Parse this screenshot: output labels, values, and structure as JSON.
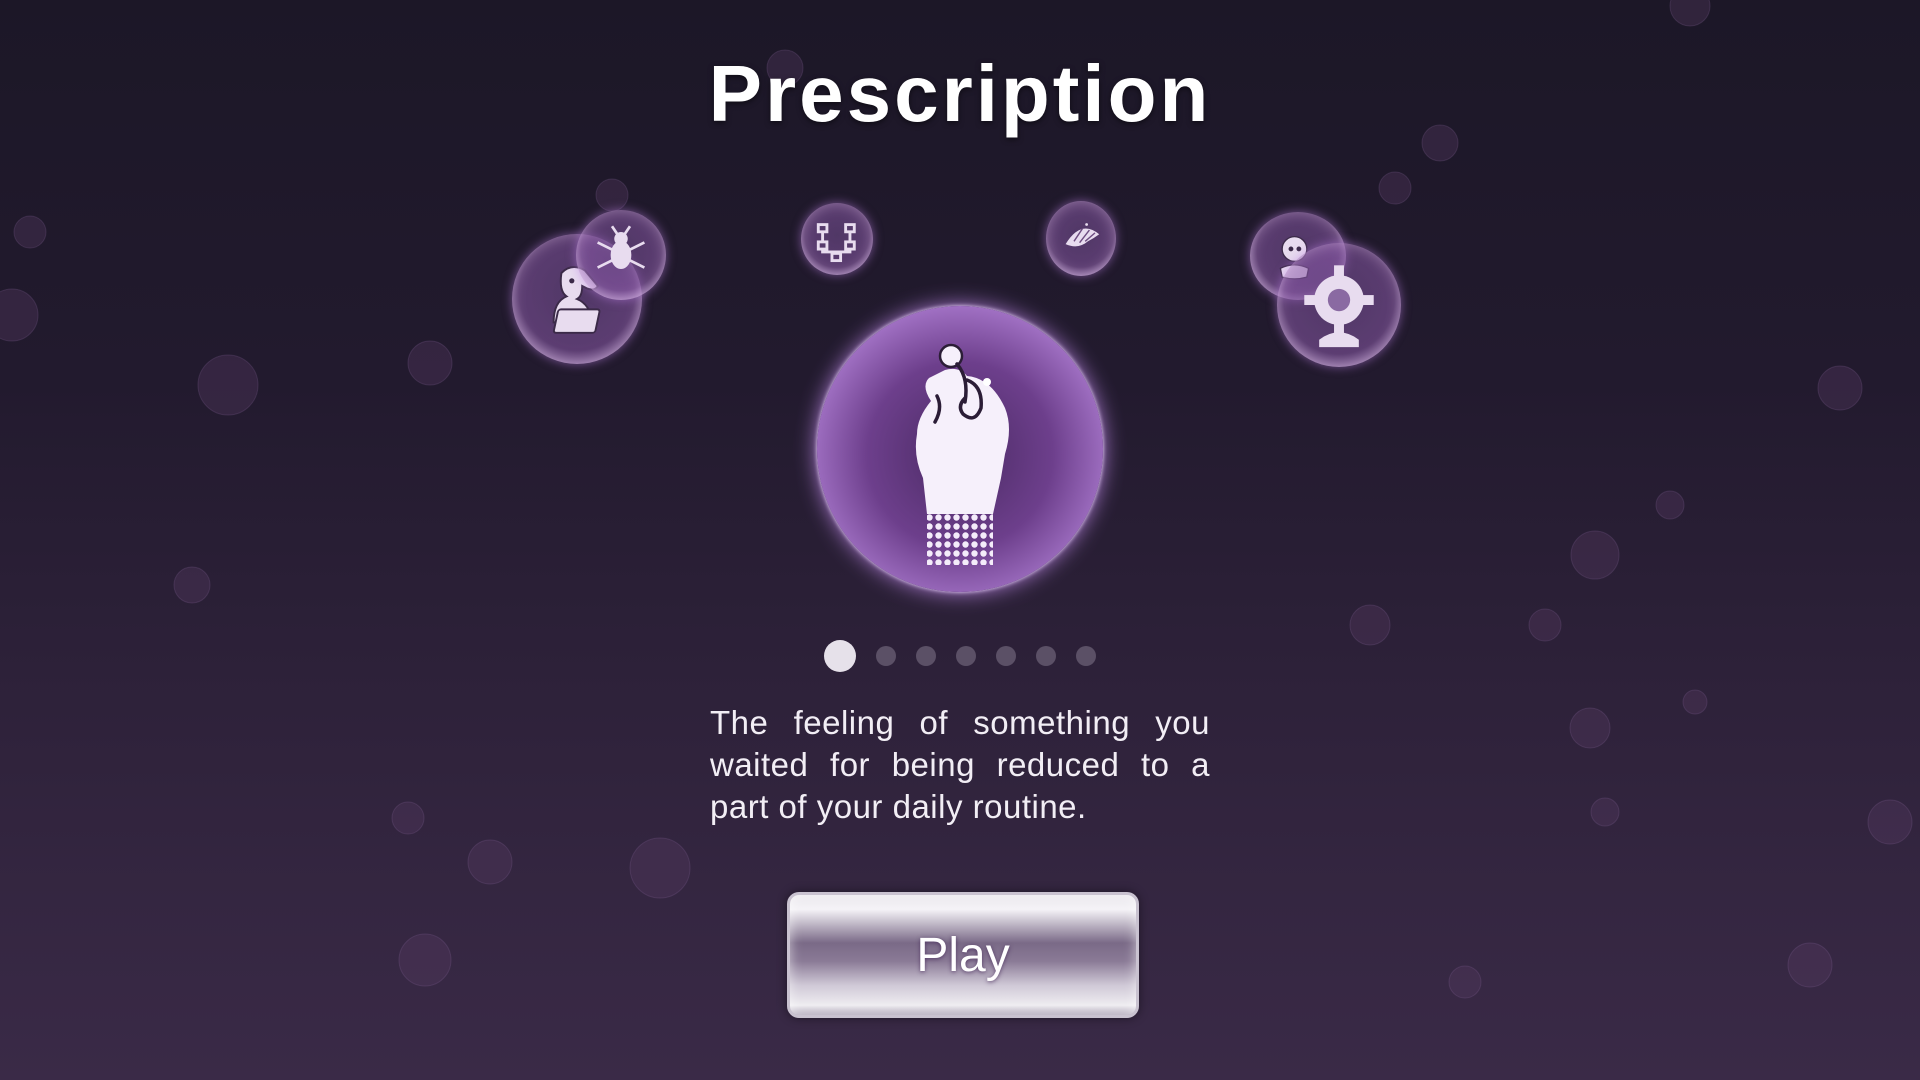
{
  "screen": {
    "title": "Prescription",
    "description": "The feeling of something you waited for being reduced to a part of your daily routine.",
    "play_label": "Play"
  },
  "carousel": {
    "total_pages": 7,
    "active_page": 1,
    "featured_icon": "hand-holding-pill-icon",
    "level_icons": [
      "scientist-with-laptop-icon",
      "insect-icon",
      "flowchart-icon",
      "fan-icon",
      "person-face-icon",
      "gear-wheel-icon"
    ]
  },
  "colors": {
    "background_top": "#1c1727",
    "background_bottom": "#3a2a47",
    "orb_glow": "#d29cff",
    "dot_active": "#e6e1ea",
    "dot_inactive": "#5b5066"
  }
}
